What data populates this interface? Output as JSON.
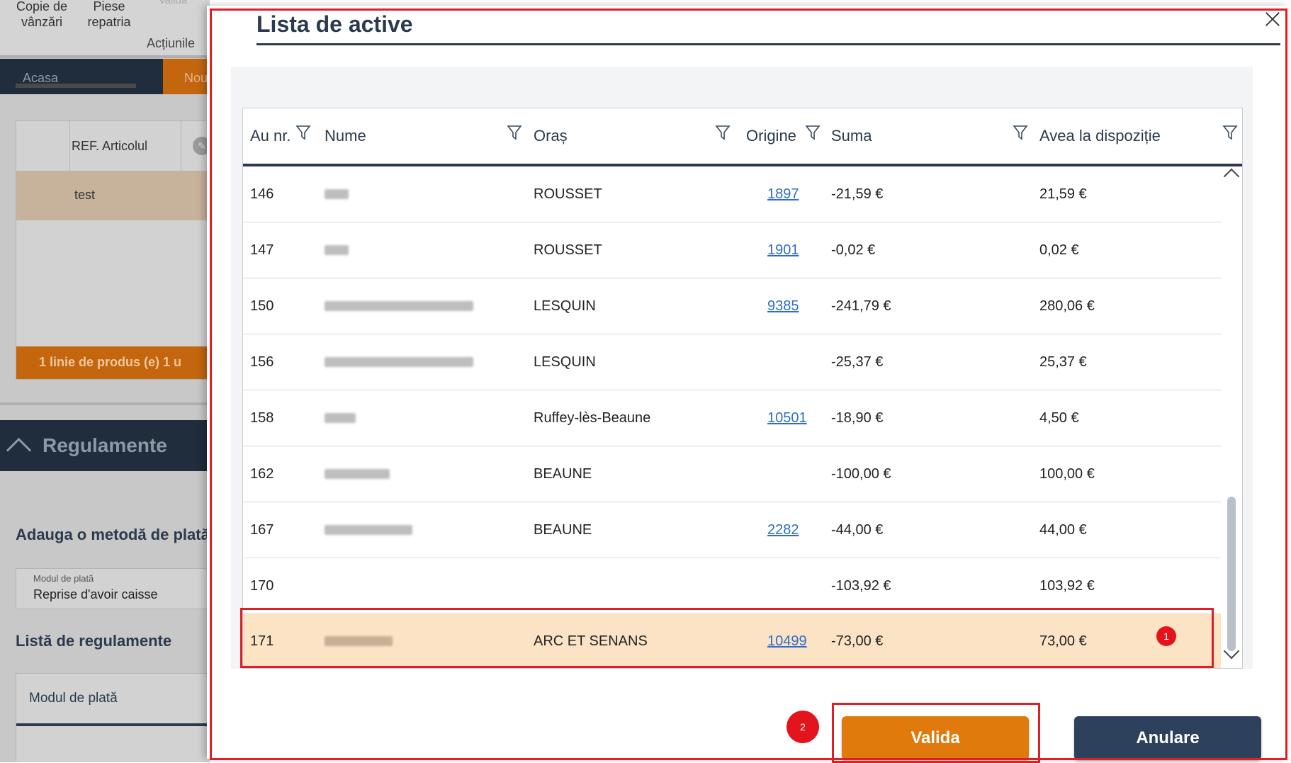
{
  "background": {
    "toolbar": {
      "copie_label": "Copie de\nvânzări",
      "piese_label": "Piese\nrepatria",
      "valida_label": "Valida",
      "actions_label": "Acțiunile"
    },
    "nav": {
      "home": "Acasa",
      "new": "Nou"
    },
    "articles": {
      "ref_header": "REF. Articolul",
      "row_value": "test",
      "footer": "1 linie de produs (e)   1 u"
    },
    "regulamente": {
      "title": "Regulamente",
      "add_method": "Adauga o metodă de plată",
      "field_label": "Modul de plată",
      "field_value": "Reprise d'avoir caisse",
      "list_title": "Listă de regulamente",
      "list_header": "Modul de plată"
    }
  },
  "modal": {
    "title": "Lista de active",
    "columns": [
      "Au nr.",
      "Nume",
      "Oraș",
      "Origine",
      "Suma",
      "Avea la dispoziție"
    ],
    "rows": [
      {
        "nr": "146",
        "city": "ROUSSET",
        "origin": "1897",
        "sum": "-21,59 €",
        "available": "21,59 €"
      },
      {
        "nr": "147",
        "city": "ROUSSET",
        "origin": "1901",
        "sum": "-0,02 €",
        "available": "0,02 €"
      },
      {
        "nr": "150",
        "city": "LESQUIN",
        "origin": "9385",
        "sum": "-241,79 €",
        "available": "280,06 €"
      },
      {
        "nr": "156",
        "city": "LESQUIN",
        "origin": "",
        "sum": "-25,37 €",
        "available": "25,37 €"
      },
      {
        "nr": "158",
        "city": "Ruffey-lès-Beaune",
        "origin": "10501",
        "sum": "-18,90 €",
        "available": "4,50 €"
      },
      {
        "nr": "162",
        "city": "BEAUNE",
        "origin": "",
        "sum": "-100,00 €",
        "available": "100,00 €"
      },
      {
        "nr": "167",
        "city": "BEAUNE",
        "origin": "2282",
        "sum": "-44,00 €",
        "available": "44,00 €"
      },
      {
        "nr": "170",
        "city": "",
        "origin": "",
        "sum": "-103,92 €",
        "available": "103,92 €"
      },
      {
        "nr": "171",
        "city": "ARC ET SENANS",
        "origin": "10499",
        "sum": "-73,00 €",
        "available": "73,00 €"
      }
    ],
    "markers": {
      "one": "1",
      "two": "2"
    },
    "buttons": {
      "valida": "Valida",
      "anulare": "Anulare"
    }
  },
  "colors": {
    "accent_orange": "#e07a0c",
    "navy": "#2d415c",
    "selected_row": "#fce3c6",
    "annotation_red": "#e01e26",
    "link_blue": "#2f6dc9"
  },
  "icons": [
    "filter-icon",
    "close-icon",
    "chevron-up-icon",
    "chevron-down-icon",
    "pencil-icon"
  ]
}
